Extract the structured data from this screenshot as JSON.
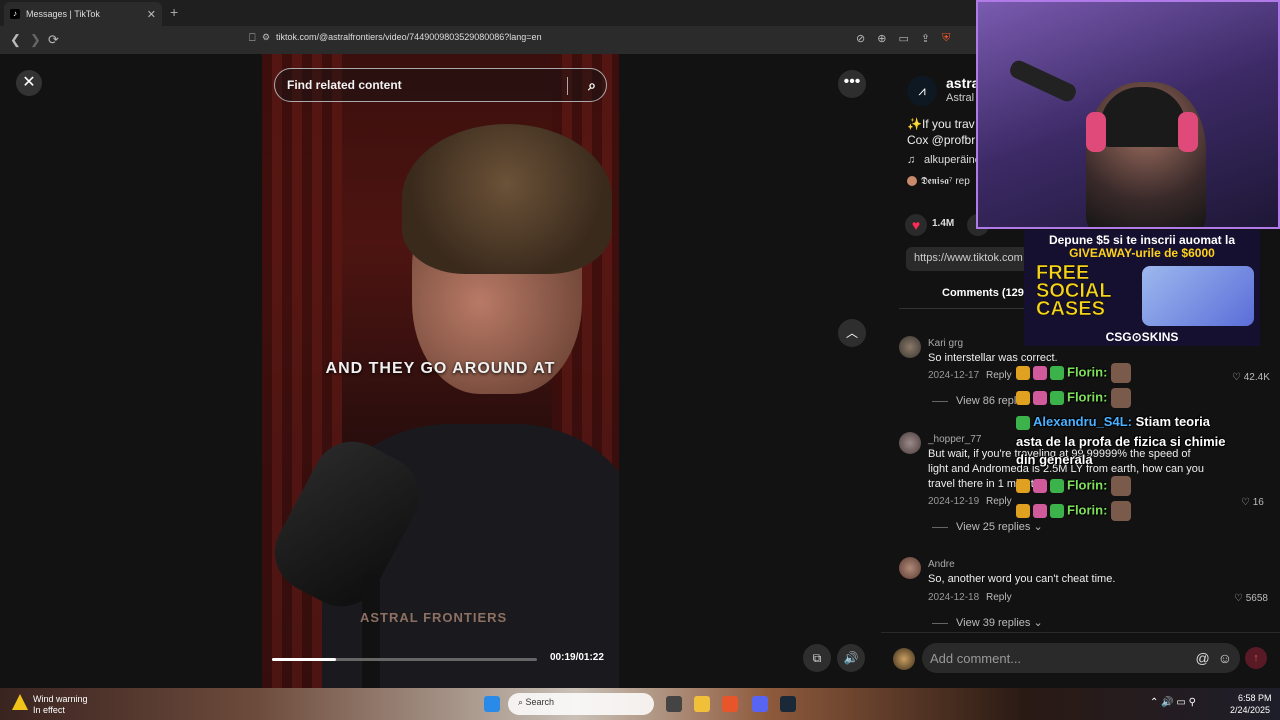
{
  "browser": {
    "tab_title": "Messages | TikTok",
    "tab_close": "✕",
    "new_tab": "+",
    "url": "tiktok.com/@astralfrontiers/video/7449009803529080086?lang=en",
    "back": "❮",
    "forward": "❯",
    "reload": "⟳"
  },
  "video": {
    "search_placeholder": "Find related content",
    "caption": "AND THEY GO AROUND AT",
    "watermark": "ASTRAL FRONTIERS",
    "progress": 0.24,
    "timecode": "00:19/01:22"
  },
  "post": {
    "author_handle": "astra",
    "author_name": "Astral",
    "desc_line1": "✨If you trav",
    "desc_line2": "Cox @profbr",
    "music": "alkuperäine",
    "reply_tag": "𝕯𝖊𝖓𝖎𝖘𝖆⁷ rep",
    "likes": "1.4M",
    "link": "https://www.tiktok.com",
    "comments_tab": "Comments (129"
  },
  "comments": [
    {
      "user": "Kari grg",
      "text": "So interstellar was correct.",
      "date": "2024-12-17",
      "reply": "Reply",
      "likes": "42.4K",
      "view": "View 86 replies"
    },
    {
      "user": "_hopper_77",
      "text1": "But wait, if you're traveling at 99.99999% the speed of",
      "text2": "light and Andromeda is 2.5M LY from earth, how can you",
      "text3": "travel there in 1 minute",
      "date": "2024-12-19",
      "reply": "Reply",
      "likes": "16",
      "view": "View 25 replies"
    },
    {
      "user": "Andre",
      "text": "So, another word you can't cheat time.",
      "date": "2024-12-18",
      "reply": "Reply",
      "likes": "5658",
      "view": "View 39 replies"
    }
  ],
  "composer": {
    "placeholder": "Add comment..."
  },
  "overlay": {
    "ad_line1": "Depune $5 si te inscrii auomat la",
    "ad_line2": "GIVEAWAY-urile de $6000",
    "ad_free1": "FREE",
    "ad_free2": "SOCIAL",
    "ad_free3": "CASES",
    "ad_brand": "CSG⊙SKINS",
    "chat": [
      {
        "name": "Florin:"
      },
      {
        "name": "Florin:"
      },
      {
        "name": "Alexandru_S4L:",
        "msg": "Stiam teoria"
      },
      {
        "msg": "asta de la profa de fizica si chimie"
      },
      {
        "msg": "din generala"
      },
      {
        "name": "Florin:"
      },
      {
        "name": "Florin:"
      }
    ]
  },
  "taskbar": {
    "weather_title": "Wind warning",
    "weather_sub": "In effect",
    "search": "Search",
    "time": "6:58 PM",
    "date": "2/24/2025"
  }
}
